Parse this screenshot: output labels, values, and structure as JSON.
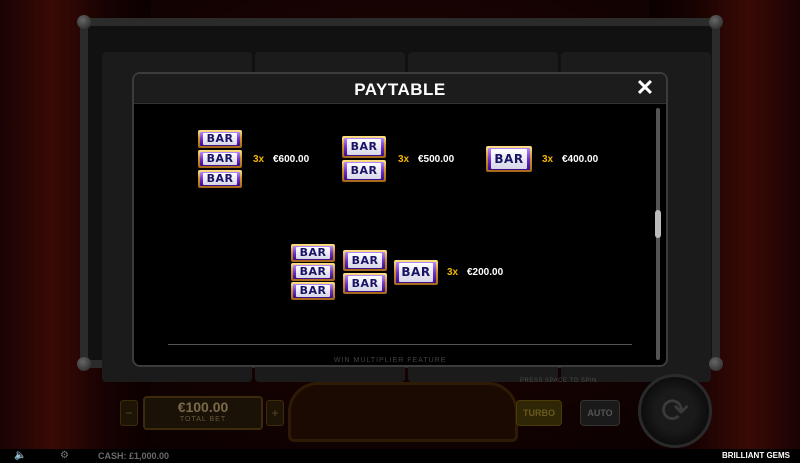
{
  "modal": {
    "title": "PAYTABLE",
    "close_glyph": "✕",
    "next_heading": "WIN MULTIPLIER FEATURE"
  },
  "symbol_label": "BAR",
  "paylines": [
    {
      "multiplier": "3x",
      "payout": "€600.00",
      "symbol": "triple-bar"
    },
    {
      "multiplier": "3x",
      "payout": "€500.00",
      "symbol": "double-bar"
    },
    {
      "multiplier": "3x",
      "payout": "€400.00",
      "symbol": "single-bar"
    },
    {
      "multiplier": "3x",
      "payout": "€200.00",
      "symbol": "any-bar"
    }
  ],
  "bottom_bar": {
    "bet_value": "€100.00",
    "bet_label": "TOTAL BET",
    "bet_minus": "−",
    "bet_plus": "+",
    "turbo_label": "TURBO",
    "auto_label": "AUTO",
    "spin_glyph": "⟳",
    "hint": "PRESS SPACE TO SPIN"
  },
  "footer": {
    "sound_icon": "🔈",
    "settings_icon": "⚙",
    "cash": "CASH: £1,000.00",
    "game_title": "BRILLIANT GEMS"
  },
  "colors": {
    "multiplier": "#f2b700",
    "modal_bg": "#000000",
    "header_bg": "#1c1c1c"
  }
}
